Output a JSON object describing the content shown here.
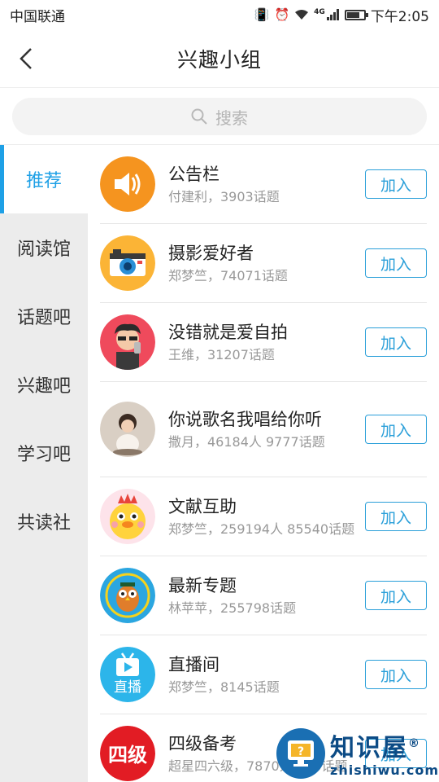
{
  "status_bar": {
    "carrier": "中国联通",
    "network": "4G",
    "time": "下午2:05",
    "battery_level": 0.75
  },
  "header": {
    "title": "兴趣小组"
  },
  "search": {
    "placeholder": "搜索"
  },
  "sidebar": {
    "items": [
      {
        "label": "推荐",
        "active": true
      },
      {
        "label": "阅读馆",
        "active": false
      },
      {
        "label": "话题吧",
        "active": false
      },
      {
        "label": "兴趣吧",
        "active": false
      },
      {
        "label": "学习吧",
        "active": false
      },
      {
        "label": "共读社",
        "active": false
      }
    ]
  },
  "groups": [
    {
      "name": "公告栏",
      "sub": "付建利，3903话题",
      "join": "加入",
      "icon": "speaker-icon",
      "color": "#f5941f"
    },
    {
      "name": "摄影爱好者",
      "sub": "郑梦竺，74071话题",
      "join": "加入",
      "icon": "camera-icon",
      "color": "#fbb436"
    },
    {
      "name": "没错就是爱自拍",
      "sub": "王维，31207话题",
      "join": "加入",
      "icon": "selfie-icon",
      "color": "#ef4a5c"
    },
    {
      "name": "你说歌名我唱给你听",
      "sub": "撒月，46184人  9777话题",
      "join": "加入",
      "icon": "child-photo-icon",
      "color": "#d9cfc4"
    },
    {
      "name": "文献互助",
      "sub": "郑梦竺，259194人  85540话题",
      "join": "加入",
      "icon": "chick-mascot-icon",
      "color": "#fde3ea"
    },
    {
      "name": "最新专题",
      "sub": "林苹苹，255798话题",
      "join": "加入",
      "icon": "owl-icon",
      "color": "#2ba6e0"
    },
    {
      "name": "直播间",
      "sub": "郑梦竺，8145话题",
      "join": "加入",
      "icon": "tv-icon",
      "color": "#2cb5ea",
      "icon_text": "直播"
    },
    {
      "name": "四级备考",
      "sub": "超星四六级，7870人  296话题",
      "join": "加入",
      "icon": "cet4-icon",
      "color": "#e21c24",
      "icon_text": "四级"
    }
  ],
  "watermark": {
    "title": "知识屋",
    "sub": "zhishiwu.com",
    "mark": "®",
    "color": "#1a6fb3"
  }
}
